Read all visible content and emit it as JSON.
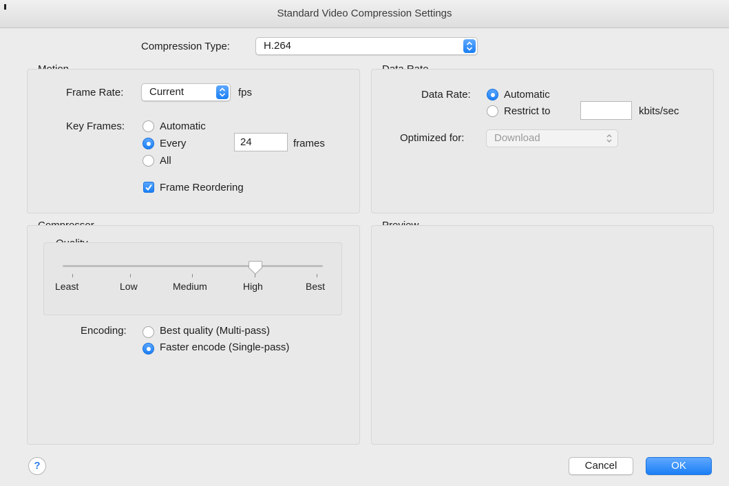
{
  "window": {
    "title": "Standard Video Compression Settings"
  },
  "compression": {
    "label": "Compression Type:",
    "value": "H.264"
  },
  "motion": {
    "title": "Motion",
    "frame_rate_label": "Frame Rate:",
    "frame_rate_value": "Current",
    "fps_label": "fps",
    "key_frames_label": "Key Frames:",
    "key_options": [
      "Automatic",
      "Every",
      "All"
    ],
    "key_selected": "Every",
    "every_value": "24",
    "frames_label": "frames",
    "reorder_label": "Frame Reordering",
    "reorder_checked": true
  },
  "data_rate": {
    "title": "Data Rate",
    "rate_label": "Data Rate:",
    "options": [
      "Automatic",
      "Restrict to"
    ],
    "selected": "Automatic",
    "restrict_value": "",
    "unit_label": "kbits/sec",
    "optimized_label": "Optimized for:",
    "optimized_value": "Download"
  },
  "compressor": {
    "title": "Compressor",
    "quality_title": "Quality",
    "quality_ticks": [
      "Least",
      "Low",
      "Medium",
      "High",
      "Best"
    ],
    "quality_value": "High",
    "encoding_label": "Encoding:",
    "encoding_options": [
      "Best quality (Multi-pass)",
      "Faster encode (Single-pass)"
    ],
    "encoding_selected": "Faster encode (Single-pass)"
  },
  "preview": {
    "title": "Preview"
  },
  "footer": {
    "help_label": "?",
    "cancel_label": "Cancel",
    "ok_label": "OK"
  },
  "colors": {
    "accent": "#1b7ff5",
    "background": "#ececec"
  },
  "icons": {
    "stepper": "up-down-chevron-icon",
    "check": "checkmark-icon",
    "help": "question-mark-icon"
  }
}
